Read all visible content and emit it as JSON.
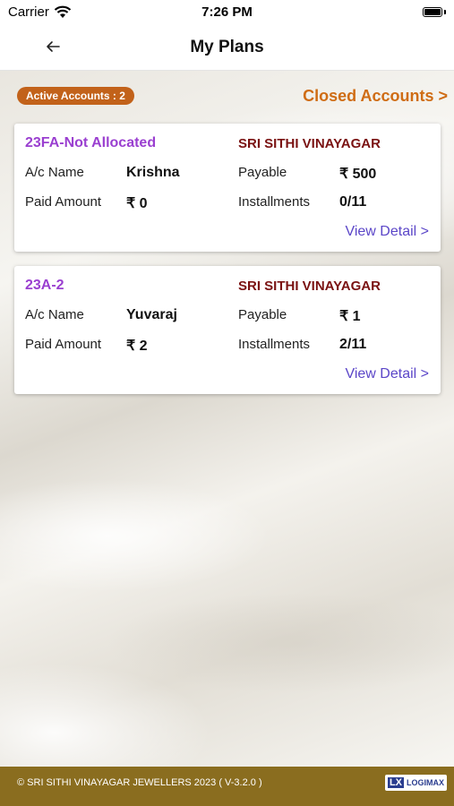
{
  "status_bar": {
    "carrier": "Carrier",
    "time": "7:26 PM"
  },
  "nav": {
    "title": "My Plans",
    "back_icon": "arrow-left-icon"
  },
  "summary": {
    "active_accounts": "Active Accounts : 2",
    "closed_accounts": "Closed Accounts >"
  },
  "labels": {
    "ac_name": "A/c Name",
    "paid_amount": "Paid Amount",
    "payable": "Payable",
    "installments": "Installments",
    "view_detail": "View Detail >"
  },
  "plans": [
    {
      "code": "23FA-Not Allocated",
      "store": "SRI SITHI VINAYAGAR",
      "ac_name": "Krishna",
      "paid_amount": "₹ 0",
      "payable": "₹ 500",
      "installments": "0/11"
    },
    {
      "code": "23A-2",
      "store": "SRI SITHI VINAYAGAR",
      "ac_name": "Yuvaraj",
      "paid_amount": "₹ 2",
      "payable": "₹ 1",
      "installments": "2/11"
    }
  ],
  "footer": {
    "copyright": "© SRI SITHI VINAYAGAR JEWELLERS 2023 ( V-3.2.0 )",
    "logo_text": "LOGIMAX",
    "logo_mark": "LX"
  },
  "colors": {
    "accent_orange": "#cf6c14",
    "badge": "#c2621a",
    "plan_code": "#9a3fd0",
    "store_name": "#7a1212",
    "link": "#5b46c8",
    "footer": "#8a6d1f"
  }
}
